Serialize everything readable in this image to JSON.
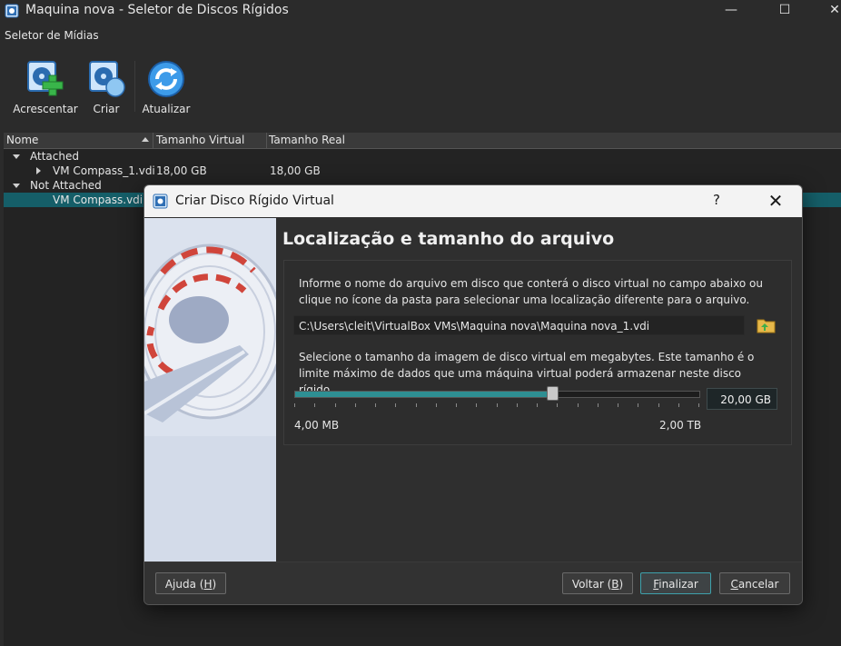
{
  "window": {
    "title": "Maquina nova - Seletor de Discos Rígidos",
    "minimize": "—",
    "maximize": "☐",
    "close": "✕"
  },
  "menubar": {
    "item": "Seletor de Mídias"
  },
  "toolbar": {
    "add_label": "Acrescentar",
    "create_label": "Criar",
    "refresh_label": "Atualizar"
  },
  "tree": {
    "headers": {
      "name": "Nome",
      "virtual_size": "Tamanho Virtual",
      "actual_size": "Tamanho Real"
    },
    "groups": [
      {
        "label": "Attached"
      },
      {
        "label": "Not Attached"
      }
    ],
    "rows": [
      {
        "name": "VM Compass_1.vdi",
        "virtual_size": "18,00 GB",
        "actual_size": "18,00 GB"
      },
      {
        "name": "VM Compass.vdi",
        "virtual_size": "",
        "actual_size": ""
      }
    ]
  },
  "dialog": {
    "title": "Criar Disco Rígido Virtual",
    "help": "?",
    "close": "✕",
    "heading": "Localização e tamanho do arquivo",
    "location_desc": "Informe o nome do arquivo em disco que conterá o disco virtual no campo abaixo ou clique no ícone da pasta para selecionar uma localização diferente para o arquivo.",
    "path": "C:\\Users\\cleit\\VirtualBox VMs\\Maquina nova\\Maquina nova_1.vdi",
    "size_desc": "Selecione o tamanho da imagem de disco virtual em megabytes. Este tamanho é o limite máximo de dados que uma máquina virtual poderá armazenar neste disco rígido.",
    "size_value": "20,00 GB",
    "slider_fraction": 0.635,
    "min_label": "4,00 MB",
    "max_label": "2,00 TB",
    "buttons": {
      "help": {
        "text": "Ajuda (",
        "key": "H",
        "tail": ")"
      },
      "back": {
        "text": "Voltar (",
        "key": "B",
        "tail": ")"
      },
      "finish": {
        "key": "F",
        "text": "inalizar"
      },
      "cancel": {
        "key": "C",
        "text": "ancelar"
      }
    }
  },
  "colors": {
    "accent": "#2e8f93",
    "selection": "#155e68"
  }
}
